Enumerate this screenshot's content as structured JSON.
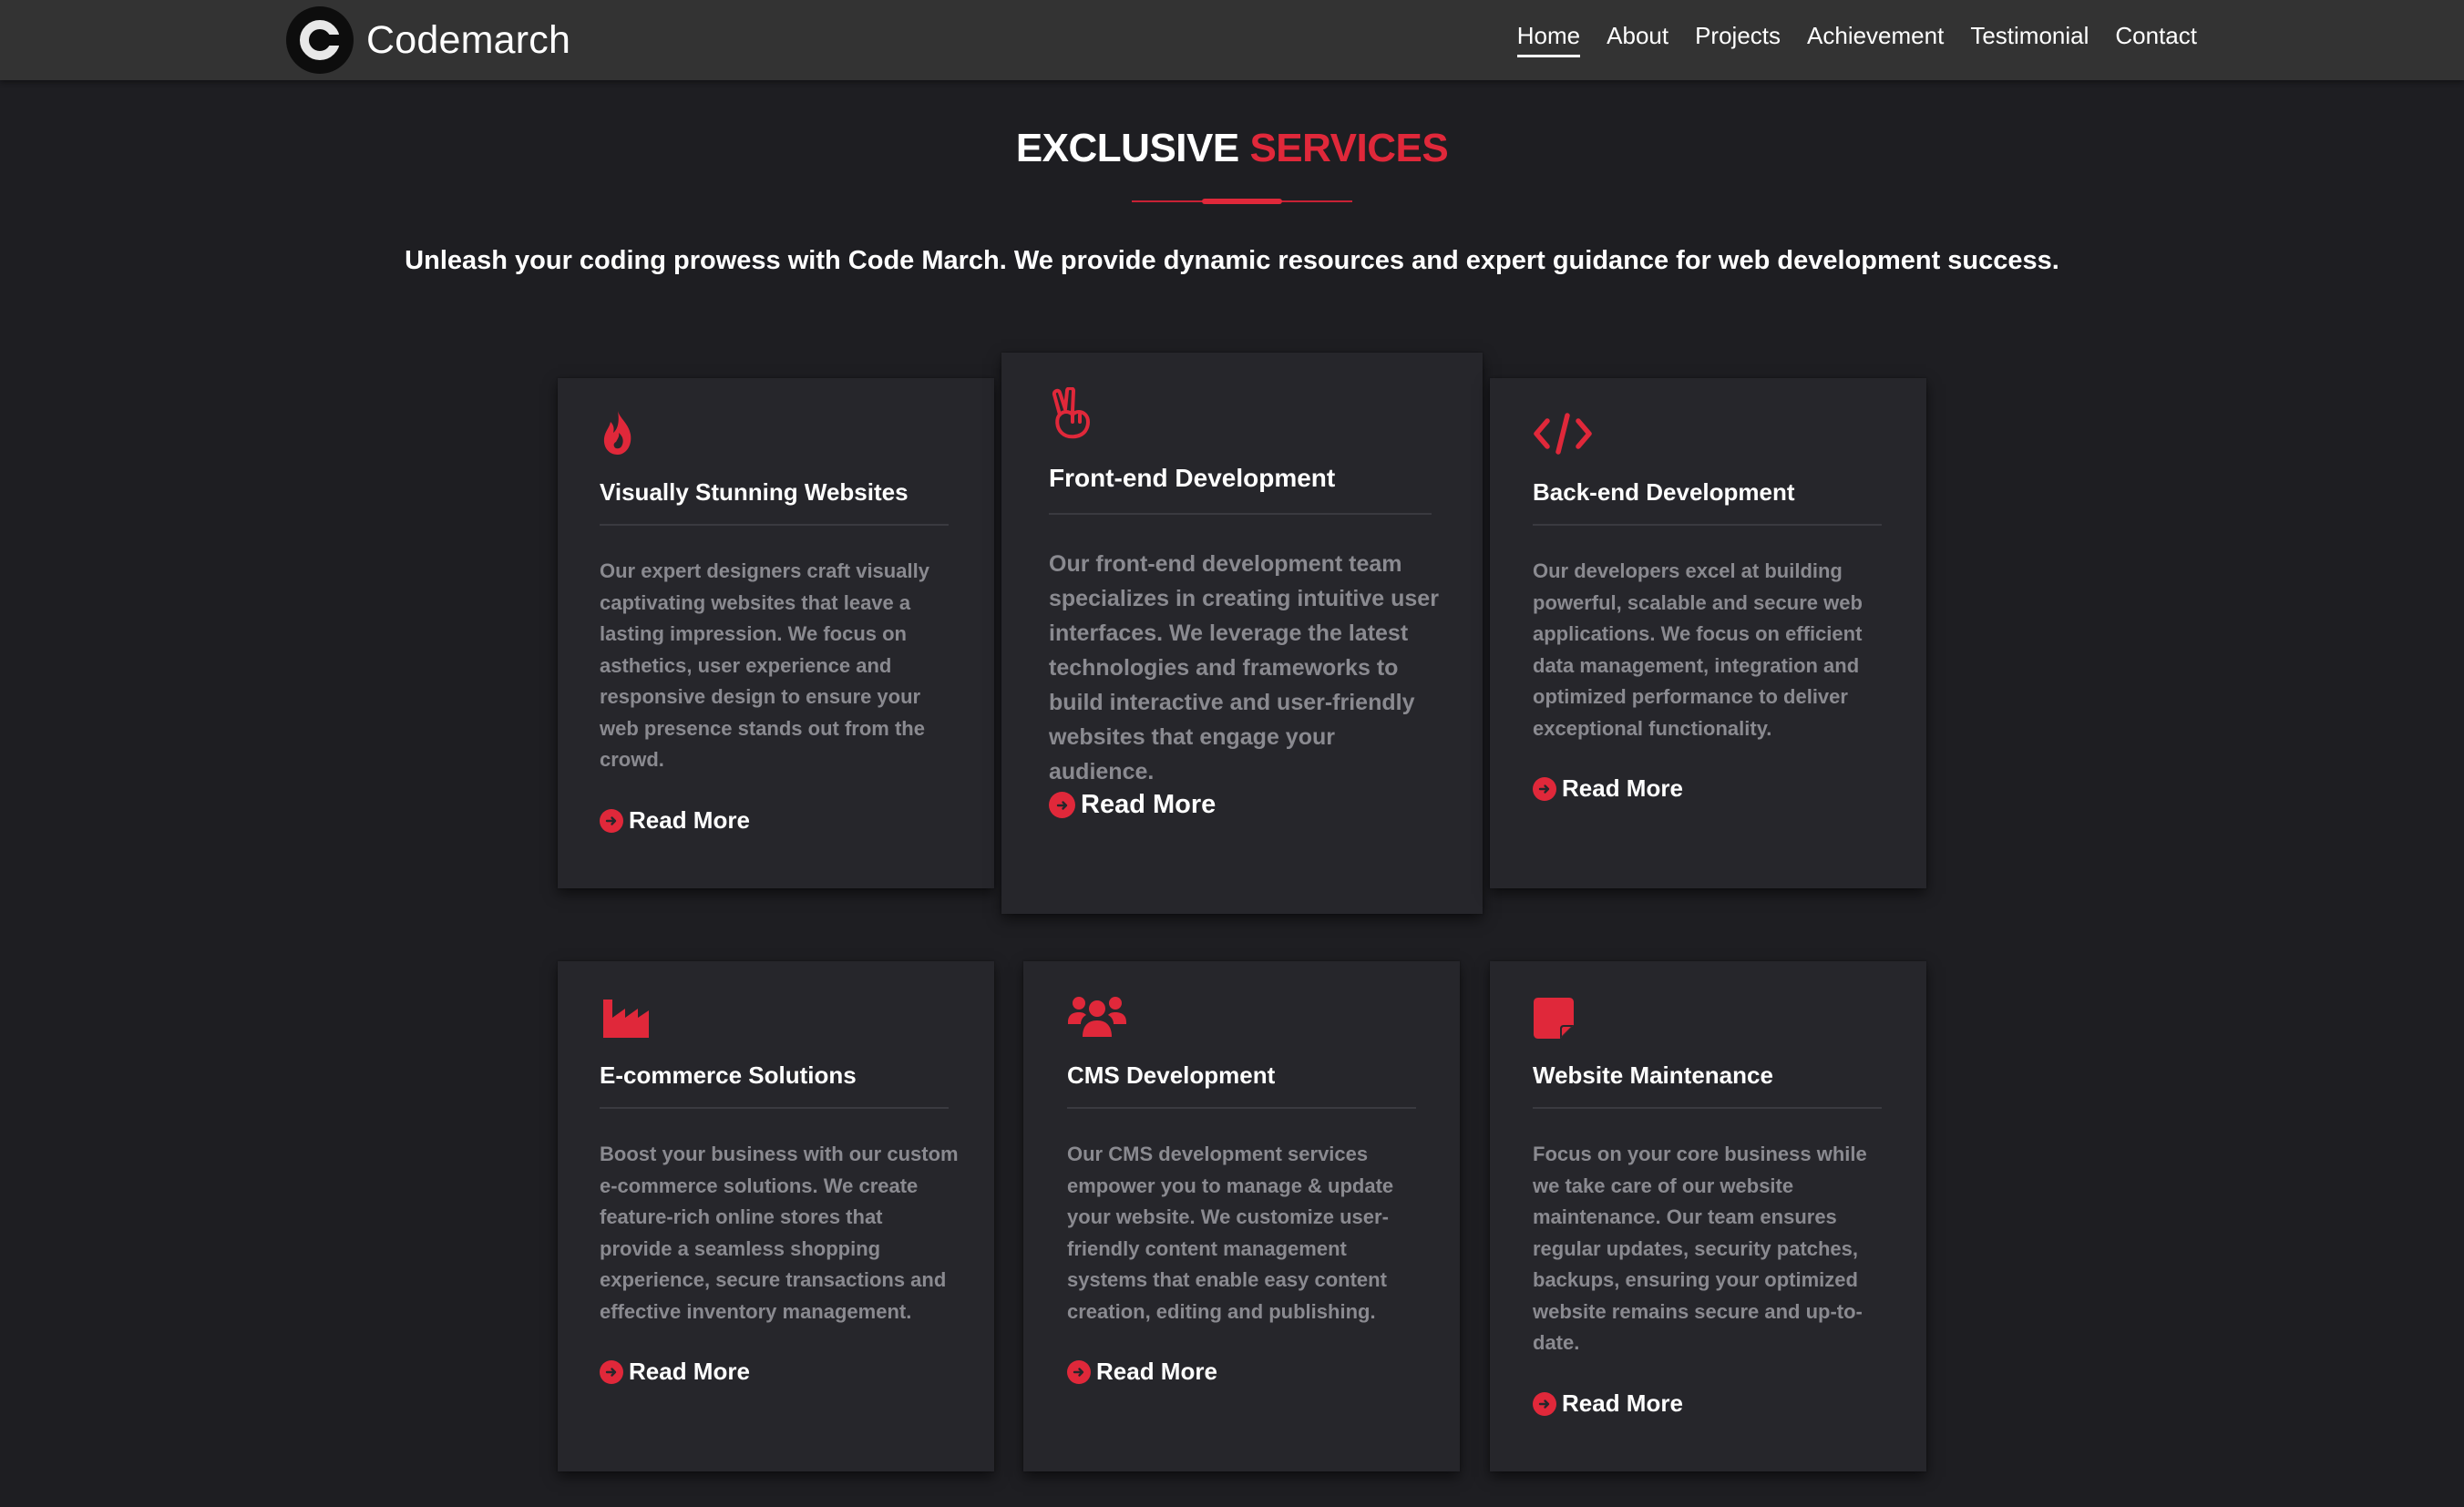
{
  "brand": {
    "name": "Codemarch",
    "logo_letter": "C"
  },
  "nav": {
    "links": [
      "Home",
      "About",
      "Projects",
      "Achievement",
      "Testimonial",
      "Contact"
    ],
    "active": "Home"
  },
  "section": {
    "title_white": "EXCLUSIVE",
    "title_accent": "SERVICES",
    "subtitle": "Unleash your coding prowess with Code March. We provide dynamic resources and expert guidance for web development success."
  },
  "colors": {
    "accent": "#e0283a",
    "background": "#1e1e22",
    "card": "#26262b",
    "navbar": "#333333"
  },
  "cards": [
    {
      "icon": "fire-icon",
      "title": "Visually Stunning Websites",
      "description": "Our expert designers craft visually captivating websites that leave a lasting impression. We focus on asthetics, user experience and responsive design to ensure your web presence stands out from the crowd.",
      "link": "Read More"
    },
    {
      "icon": "peace-hand-icon",
      "title": "Front-end Development",
      "description": "Our front-end development team specializes in creating intuitive user interfaces. We leverage the latest technologies and frameworks to build interactive and user-friendly websites that engage your audience.",
      "link": "Read More"
    },
    {
      "icon": "code-icon",
      "title": "Back-end Development",
      "description": "Our developers excel at building powerful, scalable and secure web applications. We focus on efficient data management, integration and optimized performance to deliver exceptional functionality.",
      "link": "Read More"
    },
    {
      "icon": "industry-icon",
      "title": "E-commerce Solutions",
      "description": "Boost your business with our custom e-commerce solutions. We create feature-rich online stores that provide a seamless shopping experience, secure transactions and effective inventory management.",
      "link": "Read More"
    },
    {
      "icon": "users-icon",
      "title": "CMS Development",
      "description": "Our CMS development services empower you to manage & update your website. We customize user-friendly content management systems that enable easy content creation, editing and publishing.",
      "link": "Read More"
    },
    {
      "icon": "sticky-note-icon",
      "title": "Website Maintenance",
      "description": "Focus on your core business while we take care of our website maintenance. Our team ensures regular updates, security patches, backups, ensuring your optimized website remains secure and up-to-date.",
      "link": "Read More"
    }
  ]
}
